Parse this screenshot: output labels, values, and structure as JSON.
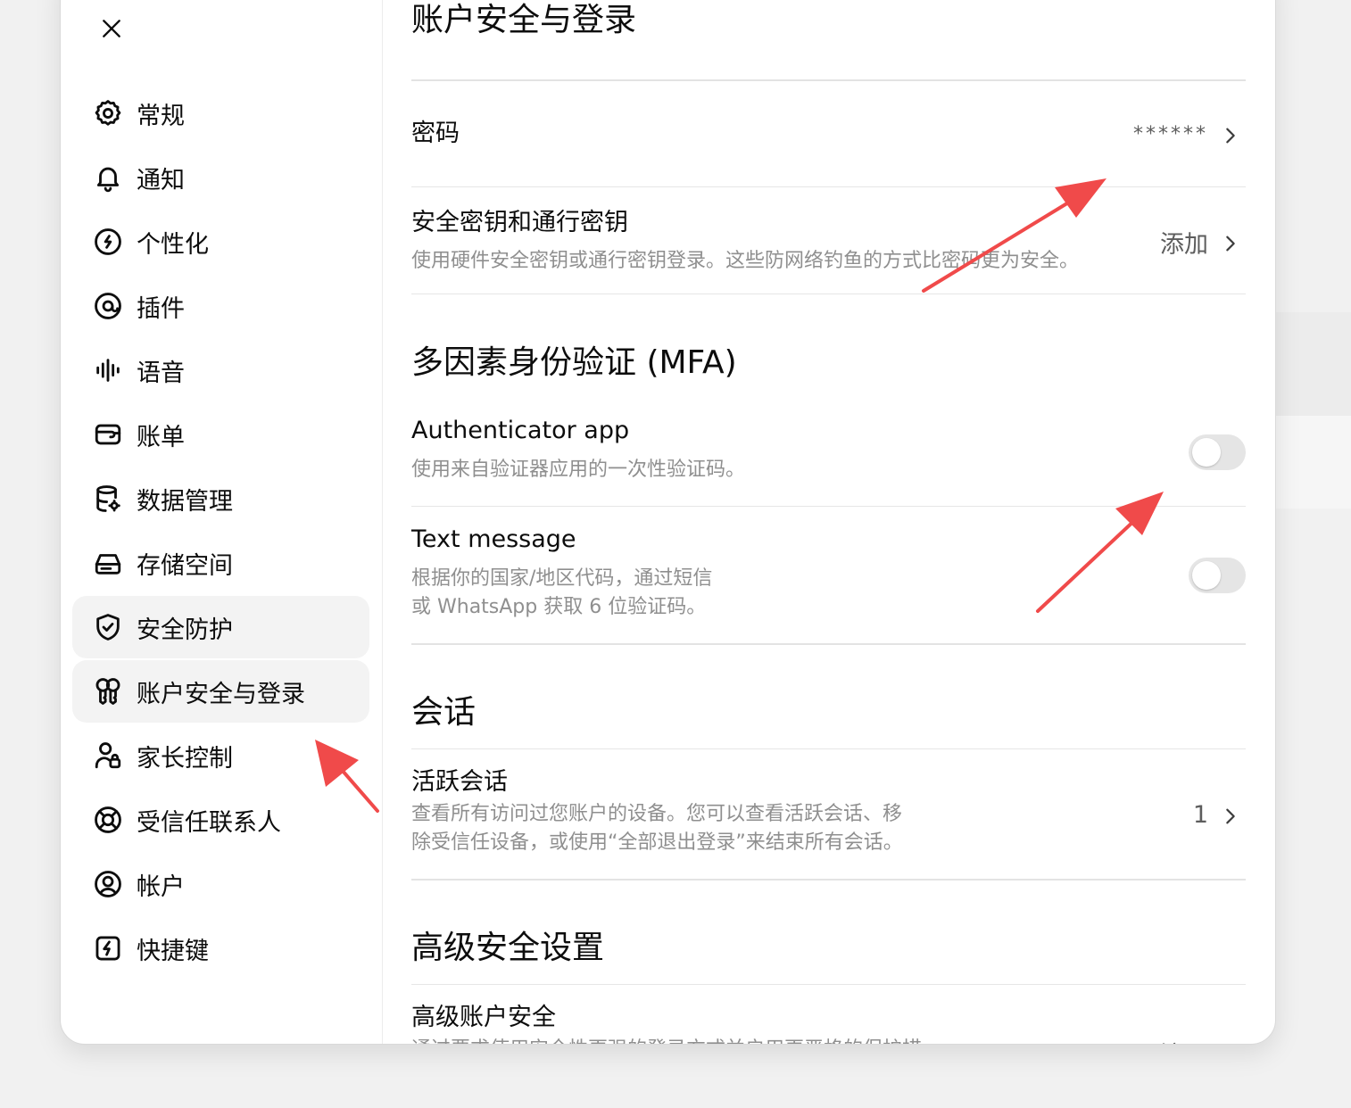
{
  "sidebar": {
    "items": [
      {
        "label": "常规",
        "icon": "gear-icon"
      },
      {
        "label": "通知",
        "icon": "bell-icon"
      },
      {
        "label": "个性化",
        "icon": "personalization-icon"
      },
      {
        "label": "插件",
        "icon": "plugin-icon"
      },
      {
        "label": "语音",
        "icon": "waveform-icon"
      },
      {
        "label": "账单",
        "icon": "wallet-icon"
      },
      {
        "label": "数据管理",
        "icon": "database-gear-icon"
      },
      {
        "label": "存储空间",
        "icon": "storage-drive-icon"
      },
      {
        "label": "安全防护",
        "icon": "shield-check-icon"
      },
      {
        "label": "账户安全与登录",
        "icon": "keys-icon"
      },
      {
        "label": "家长控制",
        "icon": "person-lock-icon"
      },
      {
        "label": "受信任联系人",
        "icon": "lifebuoy-icon"
      },
      {
        "label": "帐户",
        "icon": "user-circle-icon"
      },
      {
        "label": "快捷键",
        "icon": "lightning-icon"
      }
    ]
  },
  "main": {
    "title": "账户安全与登录",
    "password": {
      "label": "密码",
      "value": "******"
    },
    "security_keys": {
      "label": "安全密钥和通行密钥",
      "desc": "使用硬件安全密钥或通行密钥登录。这些防网络钓鱼的方式比密码更为安全。",
      "action": "添加"
    },
    "mfa": {
      "title": "多因素身份验证 (MFA)",
      "authenticator": {
        "label": "Authenticator app",
        "desc": "使用来自验证器应用的一次性验证码。",
        "enabled": false
      },
      "sms": {
        "label": "Text message",
        "desc_line1": "根据你的国家/地区代码，通过短信",
        "desc_line2": "或 WhatsApp 获取 6 位验证码。",
        "enabled": false
      }
    },
    "sessions": {
      "title": "会话",
      "active": {
        "label": "活跃会话",
        "desc_line1": "查看所有访问过您账户的设备。您可以查看活跃会话、移",
        "desc_line2": "除受信任设备，或使用“全部退出登录”来结束所有会话。",
        "count": "1"
      }
    },
    "advanced": {
      "title": "高级安全设置",
      "account": {
        "label": "高级账户安全",
        "desc": "通过要求使用安全性更强的登录方式并启用更严格的保护措",
        "action": "注册"
      }
    }
  },
  "colors": {
    "annotation_arrow": "#f04a4a",
    "active_bg": "#f3f3f3",
    "toggle_off": "#e5e5e5"
  }
}
